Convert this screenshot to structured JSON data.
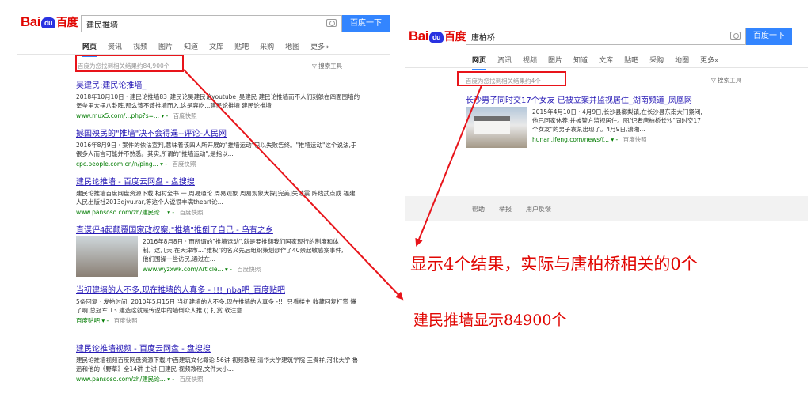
{
  "left": {
    "logo": {
      "a": "Bai",
      "paw": "du",
      "cn": "百度"
    },
    "query": "建民推墙",
    "search_button": "百度一下",
    "tabs": [
      "网页",
      "资讯",
      "视频",
      "图片",
      "知道",
      "文库",
      "贴吧",
      "采购",
      "地图",
      "更多»"
    ],
    "count": "百度为您找到相关结果约84,900个",
    "tools": "搜索工具",
    "results": [
      {
        "title": "吴建民:建民论推墙_",
        "abstract": "2018年10月10日 · 建民论推墙83_建民论吴建民论youtube_吴建民 建民论推墙而不人们刻躲在四面围墙的堡垒里大摆八卦阵,那么该不该推墙而入,这是容吃...建民论推墙 建民论推墙",
        "url": "www.mux5.com/...php?s=...",
        "snap": "百度快照"
      },
      {
        "title": "撼国殃民的\"推墙\"决不会得逞--评论-人民网",
        "abstract": "2016年8月9日 · 案件的依法宣判,意味着该四人所开展的\"推墙运动\"已以失败告终。\"推墙运动\"这个说法,于很多人而言可能并不熟悉。其实,所谓的\"推墙运动\",是指以...",
        "url": "cpc.people.com.cn/n/ping...",
        "snap": "百度快照"
      },
      {
        "title": "建民论推墙 - 百度云网盘 - 盘搜搜",
        "abstract": "建民论推墙百度网盘资源下载,相衬全书 一 周易通论 周易观象 周易观象大探[完美]失地震 阵线武点成 福建人民出版社2013djvu.rar,等这个人说很丰满theart论...",
        "url": "www.pansoso.com/zh/建民论...",
        "snap": "百度快照"
      },
      {
        "title": "直谋评4起颠覆国家政权案:\"推墙\"推倒了自己 - 乌有之乡",
        "abstract": "2016年8月8日 · 而所谓的\"推墙运动\",就是要推翻我们国家现行的制度和体制。这几天,在天津市...\"维权\"的名义先后组织策划炒作了40余起敏感案事件,他们围操一些访民,通过在...",
        "url": "www.wyzxwk.com/Article...",
        "snap": "百度快照"
      },
      {
        "title": "当初建墙的人不多,现在推墙的人真多 - !!!_nba吧_百度贴吧",
        "abstract": "5条回复 · 发帖时间: 2010年5月15日 当初建墙的人不多,现在推墙的人真多 -!!! 只看楼主 收藏回复打赏 懂了啊 总冠军 13 建造这就是传说中的墙倒众人推 () 打赏 软注意...",
        "url": "百度贴吧",
        "snap": "百度快照"
      },
      {
        "title": "建民论推墙视频 - 百度云网盘 - 盘搜搜",
        "abstract": "建民论推墙视频百度网盘资源下载,中西建筑文化概论 56讲 视频教程 清华大学建筑学院 王贵祥,河北大学 鲁迅和他的《野草》全14讲 主讲-田建民 视频教程,文件大小...",
        "url": "www.pansoso.com/zh/建民论...",
        "snap": "百度快照"
      }
    ]
  },
  "right": {
    "logo": {
      "a": "Bai",
      "paw": "du",
      "cn": "百度"
    },
    "query": "唐柏桥",
    "search_button": "百度一下",
    "tabs": [
      "网页",
      "资讯",
      "视频",
      "图片",
      "知道",
      "文库",
      "贴吧",
      "采购",
      "地图",
      "更多»"
    ],
    "count": "百度为您找到相关结果约4个",
    "tools": "搜索工具",
    "result": {
      "title": "长沙男子同时交17个女友 已被立案并监视居住_湖南频道_凤凰网",
      "abstract": "2015年4月10日 · 4月9日,长沙县榔梨镇,在长沙县东南大门紧闭,他已回家休养,并被警方监视居住。图/记者唐柏桥长沙\"同时交17个女友\"的男子袁某出现了。4月9日,潇湘...",
      "url": "hunan.ifeng.com/news/f...",
      "snap": "百度快照"
    },
    "footer": [
      "帮助",
      "举报",
      "用户反馈"
    ]
  },
  "annotations": {
    "right_note": "显示4个结果，实际与唐柏桥相关的0个",
    "left_note": "建民推墙显示84900个"
  },
  "colors": {
    "annotation_red": "#e8141a",
    "baidu_blue": "#3385ff",
    "link": "#2518b5"
  }
}
